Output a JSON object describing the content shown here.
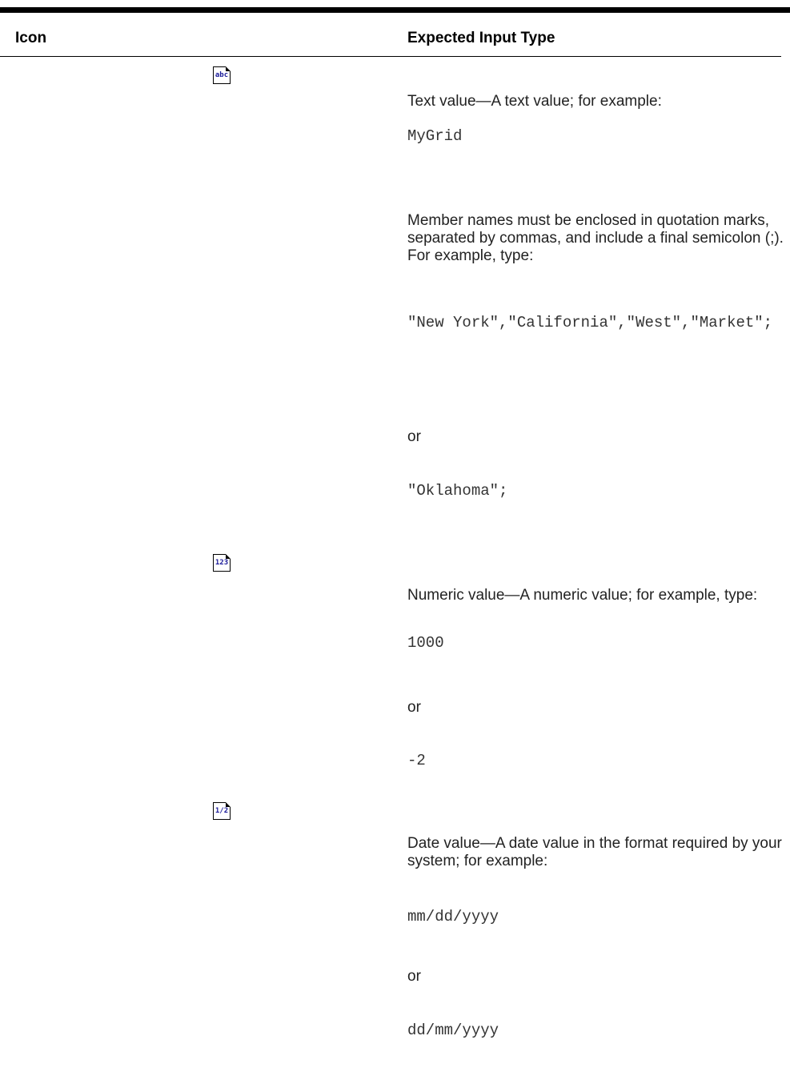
{
  "table": {
    "headers": {
      "icon": "Icon",
      "type": "Expected Input Type"
    },
    "rows": [
      {
        "icon": {
          "name": "text-value-icon",
          "glyph": "abc"
        },
        "description": "Text value—A text value; for example:",
        "example": "MyGrid",
        "note": "Member names must be enclosed in quotation marks, separated by commas, and include a final semicolon (;). For example, type:",
        "example2": "\"New York\",\"California\",\"West\",\"Market\";",
        "or_label": "or",
        "example3": "\"Oklahoma\";"
      },
      {
        "icon": {
          "name": "numeric-value-icon",
          "glyph": "123"
        },
        "description": "Numeric value—A numeric value; for example, type:",
        "example": "1000",
        "or_label": "or",
        "example2": "-2"
      },
      {
        "icon": {
          "name": "date-value-icon",
          "glyph": "1/2"
        },
        "description": "Date value—A date value in the format required by your system; for example:",
        "example": "mm/dd/yyyy",
        "or_label": "or",
        "example2": "dd/mm/yyyy"
      }
    ]
  },
  "colors": {
    "rule": "#000000",
    "text": "#222222",
    "icon_blue": "#1a1a99",
    "icon_red": "#cc0000"
  }
}
